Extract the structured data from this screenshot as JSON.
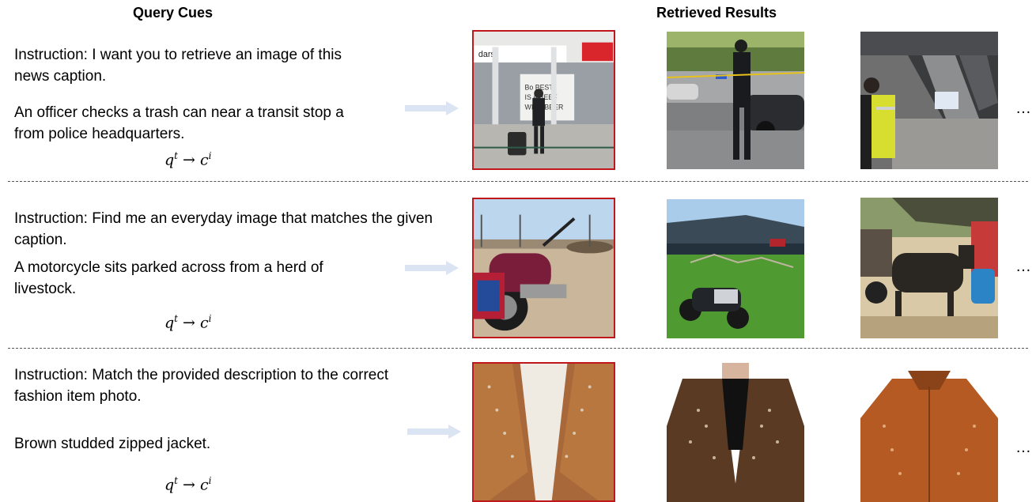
{
  "headers": {
    "query_cues": "Query Cues",
    "retrieved_results": "Retrieved Results"
  },
  "rows": [
    {
      "instruction": "Instruction: I want you to retrieve an image of this news caption.",
      "caption": "An officer checks a trash can near a transit stop a from police headquarters.",
      "formula_base_q": "q",
      "formula_sup_t": "t",
      "formula_arrow": "→",
      "formula_base_c": "c",
      "formula_sup_i": "i",
      "image_text": [
        "dars",
        "Bo BEST",
        "IS A BEEF",
        "WITH BEER"
      ],
      "ellipsis": "…"
    },
    {
      "instruction": "Instruction: Find me an everyday image that matches the given caption.",
      "caption": "A motorcycle sits parked across from a herd of livestock.",
      "formula_base_q": "q",
      "formula_sup_t": "t",
      "formula_arrow": "→",
      "formula_base_c": "c",
      "formula_sup_i": "i",
      "ellipsis": "…"
    },
    {
      "instruction": "Instruction: Match the provided description to the correct fashion item photo.",
      "caption": "Brown studded zipped jacket.",
      "formula_base_q": "q",
      "formula_sup_t": "t",
      "formula_arrow": "→",
      "formula_base_c": "c",
      "formula_sup_i": "i",
      "ellipsis": "…"
    }
  ],
  "colors": {
    "selected_border": "#c0171d",
    "arrow": "#dbe4f2",
    "divider": "#555555"
  }
}
